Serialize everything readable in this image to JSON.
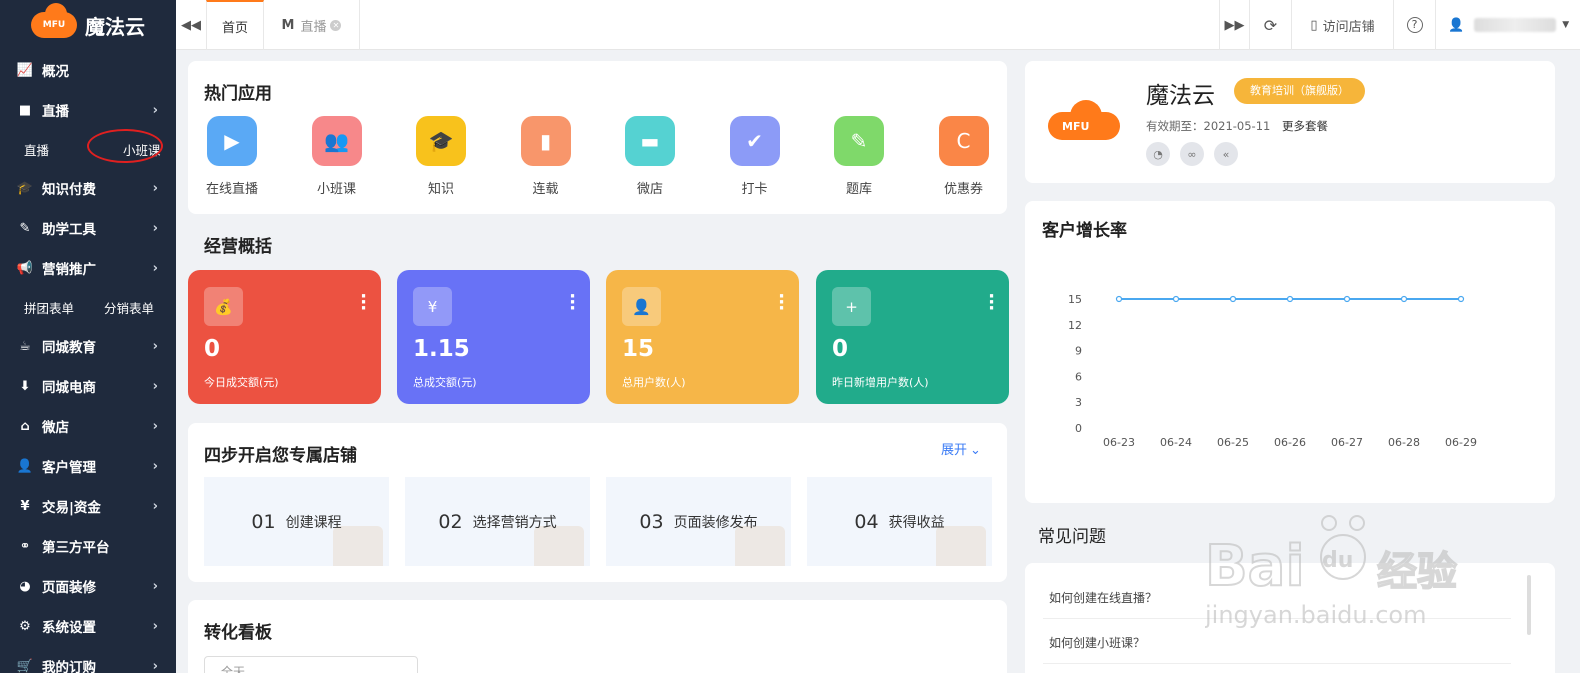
{
  "brand": {
    "logo_text": "MFU",
    "name": "魔法云"
  },
  "sidebar": {
    "items": [
      {
        "label": "概况",
        "icon": "📈",
        "icon_name": "chart-line-icon",
        "chevron": false
      },
      {
        "label": "直播",
        "icon": "■",
        "icon_name": "video-camera-icon",
        "chevron": true
      },
      {
        "label": "知识付费",
        "icon": "🎓",
        "icon_name": "graduation-cap-icon",
        "chevron": true
      },
      {
        "label": "助学工具",
        "icon": "✎",
        "icon_name": "eraser-icon",
        "chevron": true
      },
      {
        "label": "营销推广",
        "icon": "📢",
        "icon_name": "bullhorn-icon",
        "chevron": true
      },
      {
        "label": "同城教育",
        "icon": "☕",
        "icon_name": "coffee-icon",
        "chevron": true
      },
      {
        "label": "同城电商",
        "icon": "⬇",
        "icon_name": "download-icon",
        "chevron": true
      },
      {
        "label": "微店",
        "icon": "⌂",
        "icon_name": "home-icon",
        "chevron": true
      },
      {
        "label": "客户管理",
        "icon": "👤",
        "icon_name": "user-icon",
        "chevron": true
      },
      {
        "label": "交易|资金",
        "icon": "¥",
        "icon_name": "yen-icon",
        "chevron": true
      },
      {
        "label": "第三方平台",
        "icon": "⚭",
        "icon_name": "cubes-icon",
        "chevron": false
      },
      {
        "label": "页面装修",
        "icon": "◕",
        "icon_name": "dashboard-icon",
        "chevron": true
      },
      {
        "label": "系统设置",
        "icon": "⚙",
        "icon_name": "gear-icon",
        "chevron": true
      },
      {
        "label": "我的订购",
        "icon": "🛒",
        "icon_name": "cart-icon",
        "chevron": true
      }
    ],
    "live_sub": [
      "直播",
      "小班课"
    ],
    "marketing_sub": [
      "拼团表单",
      "分销表单"
    ]
  },
  "topbar": {
    "tabs": [
      {
        "label": "首页"
      },
      {
        "label": "直播",
        "icon": "M"
      }
    ],
    "visit_store": "访问店铺",
    "help": "?"
  },
  "hot_apps": {
    "title": "热门应用",
    "items": [
      {
        "label": "在线直播",
        "color": "#5aa9f5",
        "icon": "▶"
      },
      {
        "label": "小班课",
        "color": "#f7888a",
        "icon": "👥"
      },
      {
        "label": "知识",
        "color": "#f8c21c",
        "icon": "🎓"
      },
      {
        "label": "连载",
        "color": "#f8966b",
        "icon": "▮"
      },
      {
        "label": "微店",
        "color": "#55d2d2",
        "icon": "▬"
      },
      {
        "label": "打卡",
        "color": "#8c9bf7",
        "icon": "✔"
      },
      {
        "label": "题库",
        "color": "#7fd96a",
        "icon": "✎"
      },
      {
        "label": "优惠券",
        "color": "#fa8647",
        "icon": "C"
      }
    ]
  },
  "overview": {
    "title": "经营概括",
    "cards": [
      {
        "value": "0",
        "caption": "今日成交额(元)",
        "color": "#ec5241",
        "icon": "💰"
      },
      {
        "value": "1.15",
        "caption": "总成交额(元)",
        "color": "#6872f6",
        "icon": "¥"
      },
      {
        "value": "15",
        "caption": "总用户数(人)",
        "color": "#f6b648",
        "icon": "👤"
      },
      {
        "value": "0",
        "caption": "昨日新增用户数(人)",
        "color": "#21ab8b",
        "icon": "+"
      }
    ]
  },
  "steps": {
    "title": "四步开启您专属店铺",
    "expand": "展开",
    "items": [
      {
        "num": "01",
        "label": "创建课程"
      },
      {
        "num": "02",
        "label": "选择营销方式"
      },
      {
        "num": "03",
        "label": "页面装修发布"
      },
      {
        "num": "04",
        "label": "获得收益"
      }
    ]
  },
  "board": {
    "title": "转化看板",
    "select_text": "全天"
  },
  "store": {
    "name": "魔法云",
    "badge": "教育培训（旗舰版）",
    "expiry_label": "有效期至：",
    "expiry": "2021-05-11",
    "more": "更多套餐",
    "accent": "#f6b53a"
  },
  "chart_data": {
    "type": "line",
    "title": "客户增长率",
    "categories": [
      "06-23",
      "06-24",
      "06-25",
      "06-26",
      "06-27",
      "06-28",
      "06-29"
    ],
    "values": [
      15,
      15,
      15,
      15,
      15,
      15,
      15
    ],
    "yticks": [
      0,
      3,
      6,
      9,
      12,
      15
    ],
    "ylim": [
      0,
      15
    ],
    "color": "#4aa8f0",
    "grid": false
  },
  "faq": {
    "title": "常见问题",
    "items": [
      "如何创建在线直播？",
      "如何创建小班课？"
    ]
  },
  "watermark": {
    "text1": "Bai",
    "text2": "du",
    "text3": "经验",
    "url": "jingyan.baidu.com"
  }
}
